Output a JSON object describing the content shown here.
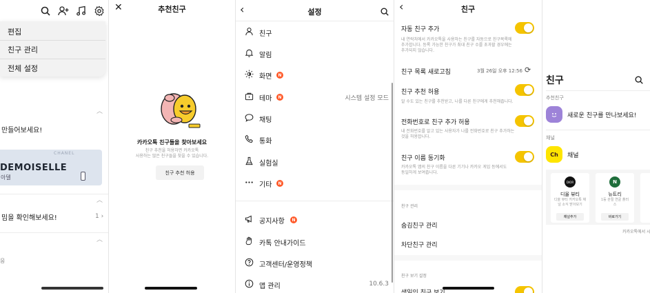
{
  "p1": {
    "menu": [
      "편집",
      "친구 관리",
      "전체 설정"
    ],
    "make_text": "만들어보세요!",
    "banner": {
      "brand": "CHANEL",
      "title": "DEMOISELLE",
      "subtitle": "아델"
    },
    "check_text": "밈을 확인해보세요!",
    "count": "1",
    "footer_char": "응"
  },
  "p2": {
    "title": "추천친구",
    "headline": "카카오톡 친구들을 찾아보세요",
    "desc_line1": "친구 추천을 허용하면 카카오톡",
    "desc_line2": "사용하는 많은 친구들을 찾을 수 있습니다.",
    "allow_button": "친구 추천 허용"
  },
  "p3": {
    "title": "설정",
    "items": [
      {
        "label": "친구",
        "icon": "person-icon",
        "badge": ""
      },
      {
        "label": "알림",
        "icon": "bell-icon",
        "badge": ""
      },
      {
        "label": "화면",
        "icon": "brightness-icon",
        "badge": "N"
      },
      {
        "label": "테마",
        "icon": "theme-icon",
        "badge": "N",
        "value": "시스템 설정 모드"
      },
      {
        "label": "채팅",
        "icon": "chat-icon",
        "badge": ""
      },
      {
        "label": "통화",
        "icon": "phone-icon",
        "badge": ""
      },
      {
        "label": "실험실",
        "icon": "flask-icon",
        "badge": ""
      },
      {
        "label": "기타",
        "icon": "more-icon",
        "badge": "N"
      }
    ],
    "items2": [
      {
        "label": "공지사항",
        "icon": "megaphone-icon",
        "badge": "N"
      },
      {
        "label": "카톡 안내가이드",
        "icon": "hand-icon",
        "badge": ""
      },
      {
        "label": "고객센터/운영정책",
        "icon": "help-icon",
        "badge": ""
      },
      {
        "label": "앱 관리",
        "icon": "info-icon",
        "badge": "",
        "value": "10.6.3"
      }
    ]
  },
  "p4": {
    "title": "친구",
    "auto_add": "자동 친구 추가",
    "auto_add_desc": [
      "내 연락처에서 카카오톡을 사용하는 친구를 자동으로 친구목록에",
      "추가합니다. 등록 가능한 친구가 최대 친구 수를 초과할 경우에는",
      "추가되지 않습니다."
    ],
    "refresh": "친구 목록 새로고침",
    "refresh_time": "3월 26일 오후 12:56",
    "recommend": "친구 추천 허용",
    "recommend_desc": [
      "알 수도 있는 친구를 추천받고, 나를 다른 친구에게 추천해줍니다."
    ],
    "phone_add": "전화번호로 친구 추가 허용",
    "phone_add_desc": [
      "내 전화번호를 알고 있는 사용자가 나를 전화번호로 친구 추가하는",
      "것을 허용합니다."
    ],
    "name_sync": "친구 이름 동기화",
    "name_sync_desc": [
      "카카오톡 앱의 친구 이름을 다른 기기나 카카오 게임 등에서도",
      "동일하게 보여줍니다."
    ],
    "section_manage": "친구 관리",
    "hidden": "숨김친구 관리",
    "blocked": "차단친구 관리",
    "section_view": "친구 보기 설정",
    "cut_item": "생일인 친구 보기"
  },
  "p5": {
    "title": "친구",
    "recommend_section": "추천친구",
    "meet": "새로운 친구를 만나보세요!",
    "channel_section": "채널",
    "channel_label": "채널",
    "cards": [
      {
        "logo": "DIOR",
        "name": "디올 뷰티",
        "desc": "디올 뷰티 카카오톡 채널 소식 받아보기",
        "button": "채널추가"
      },
      {
        "logo": "N",
        "name": "뉴트리",
        "desc": "1등 관절 연골 플러스",
        "button": "바로가기"
      }
    ],
    "footer": "카카오톡에서 시"
  },
  "colors": {
    "accent": "#f5c400",
    "badge": "#ff5a2a",
    "kakao_yellow": "#fee500"
  }
}
